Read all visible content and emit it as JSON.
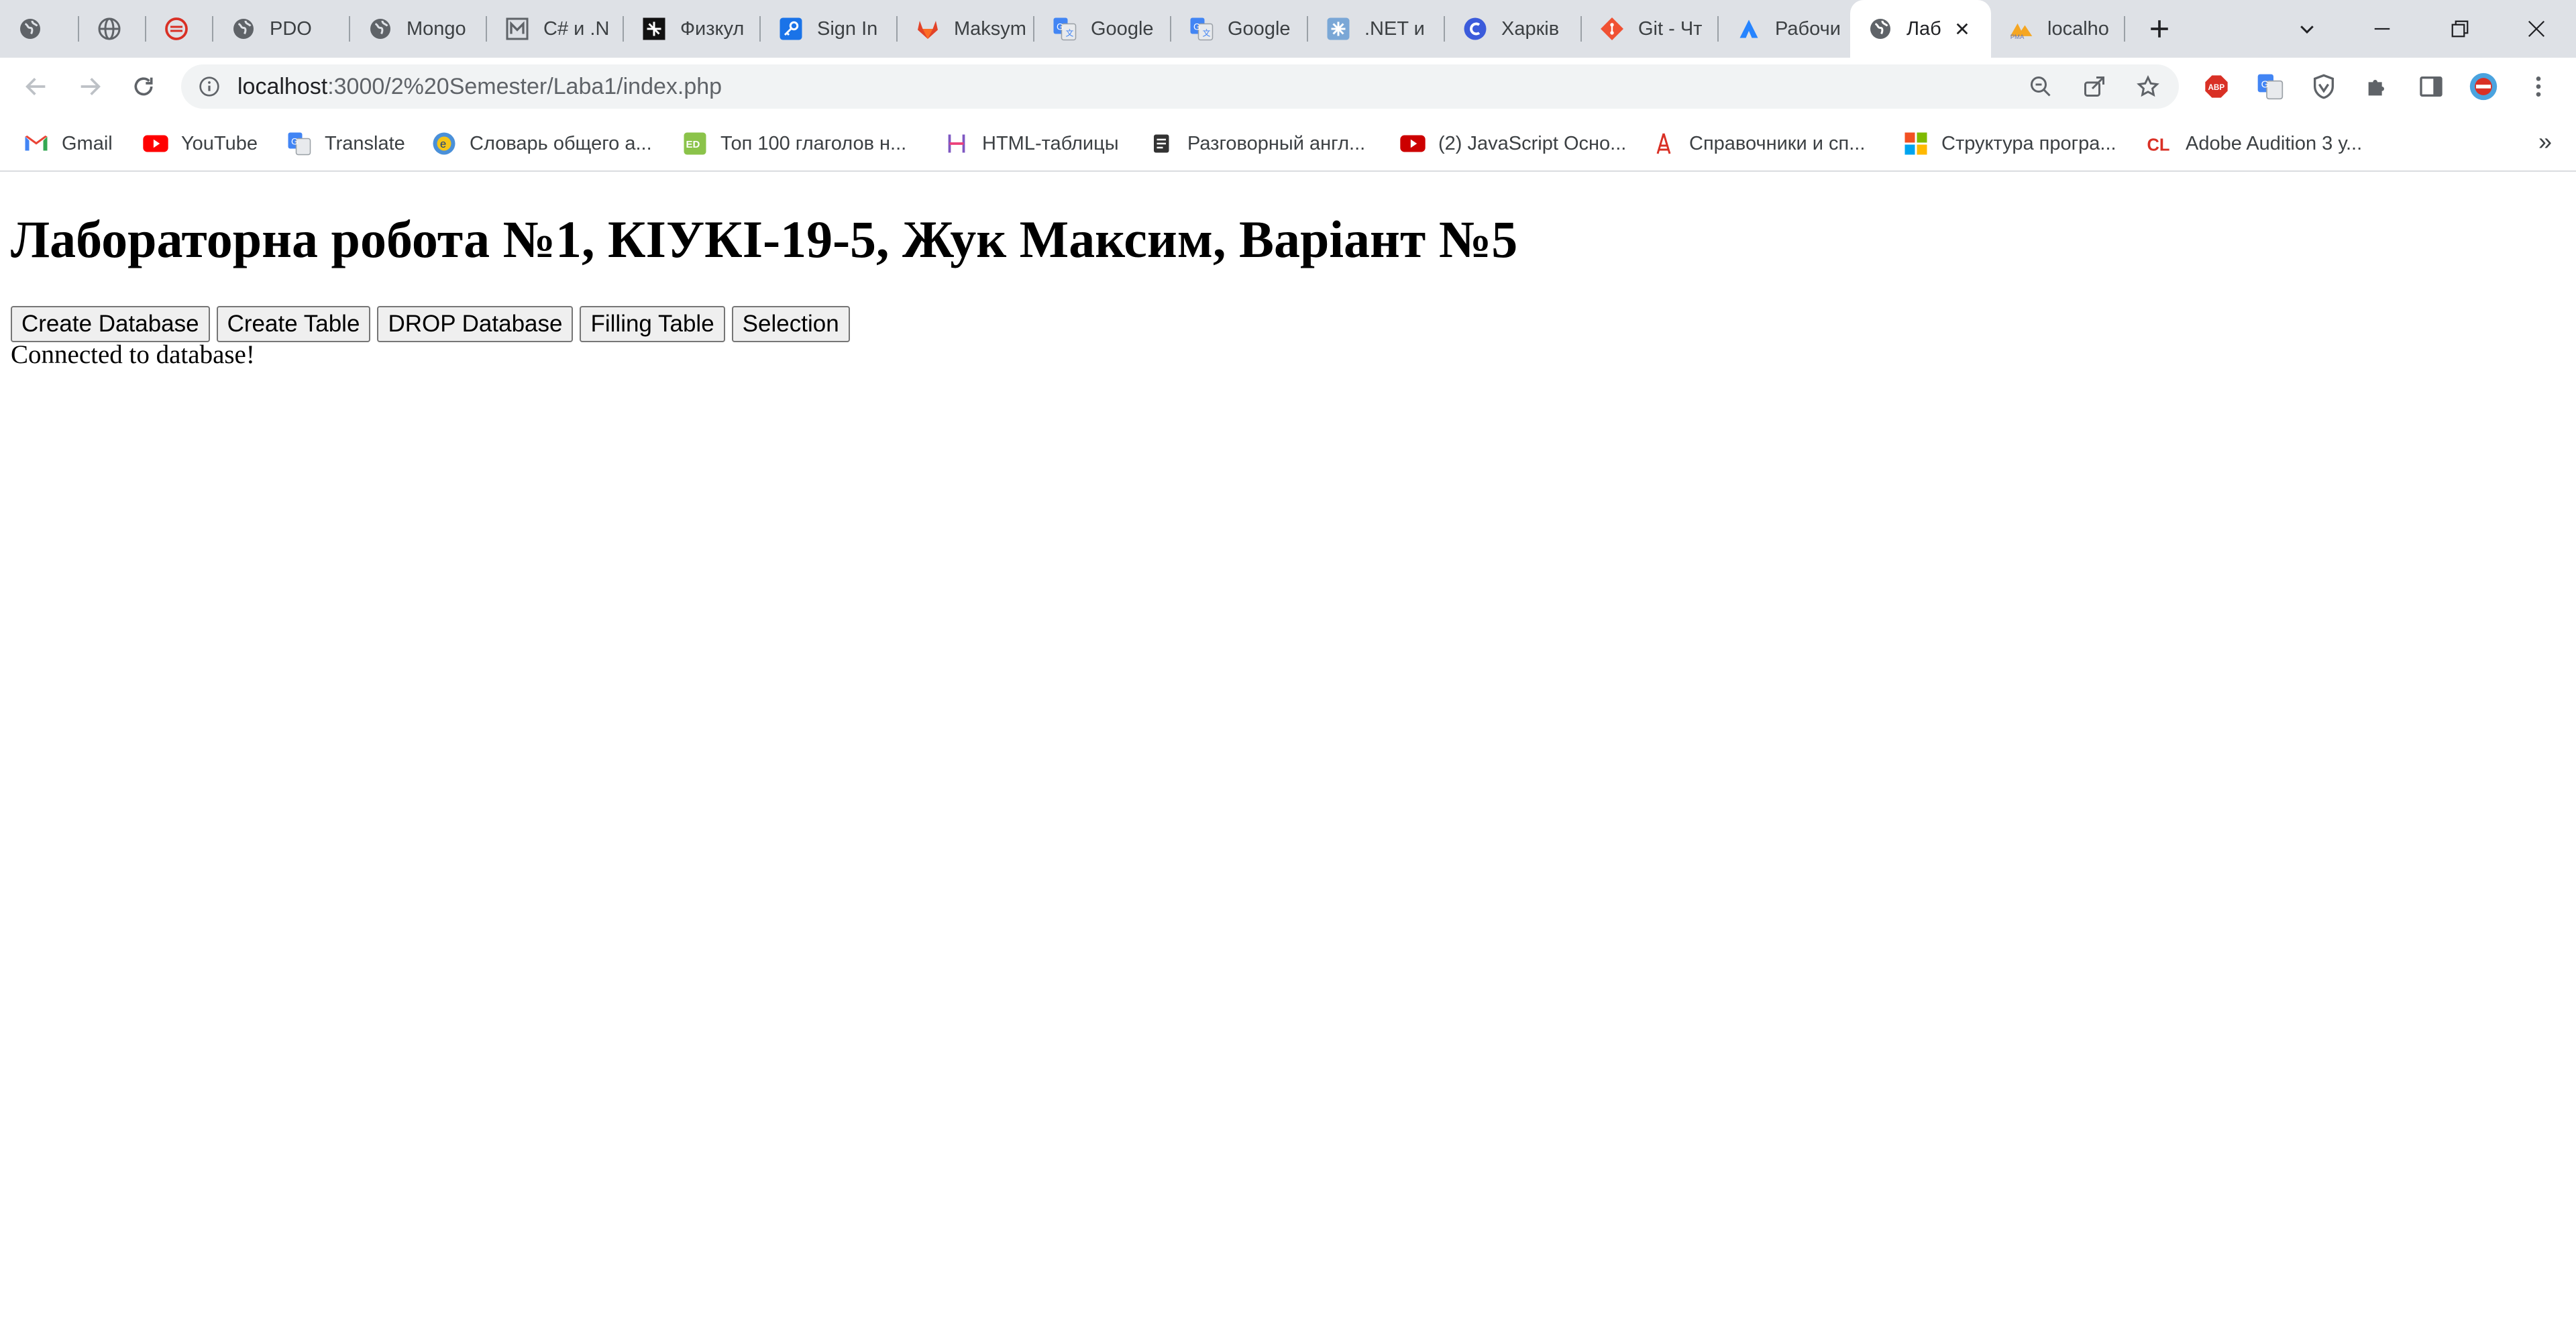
{
  "tabs": [
    {
      "title": "",
      "icon": "globe-icon"
    },
    {
      "title": "",
      "icon": "world-icon"
    },
    {
      "title": "",
      "icon": "opera-icon"
    },
    {
      "title": "PDO",
      "icon": "globe-icon"
    },
    {
      "title": "Mongo",
      "icon": "globe-icon"
    },
    {
      "title": "C# и .N",
      "icon": "m-icon"
    },
    {
      "title": "Физкул",
      "icon": "dark-logo-icon"
    },
    {
      "title": "Sign In",
      "icon": "key-icon"
    },
    {
      "title": "Maksym",
      "icon": "gitlab-icon"
    },
    {
      "title": "Google",
      "icon": "google-translate-icon"
    },
    {
      "title": "Google",
      "icon": "google-translate-icon"
    },
    {
      "title": ".NET и",
      "icon": "asterisk-icon"
    },
    {
      "title": "Харків",
      "icon": "c-icon"
    },
    {
      "title": "Git - Чт",
      "icon": "git-icon"
    },
    {
      "title": "Рабочи",
      "icon": "atlassian-icon"
    },
    {
      "title": "Лаб",
      "icon": "globe-icon",
      "active": true
    },
    {
      "title": "localho",
      "icon": "phpmyadmin-icon"
    }
  ],
  "address_bar": {
    "host": "localhost",
    "path": ":3000/2%20Semester/Laba1/index.php"
  },
  "bookmarks": [
    {
      "label": "Gmail",
      "icon": "gmail-icon"
    },
    {
      "label": "YouTube",
      "icon": "youtube-icon"
    },
    {
      "label": "Translate",
      "icon": "google-translate-icon"
    },
    {
      "label": "Словарь общего а...",
      "icon": "e-icon"
    },
    {
      "label": "Топ 100 глаголов н...",
      "icon": "ed-icon"
    },
    {
      "label": "HTML-таблицы",
      "icon": "html-icon"
    },
    {
      "label": "Разговорный англ...",
      "icon": "scroll-icon"
    },
    {
      "label": "(2) JavaScript Осно...",
      "icon": "youtube-icon"
    },
    {
      "label": "Справочники и сп...",
      "icon": "tower-icon"
    },
    {
      "label": "Структура програ...",
      "icon": "microsoft-icon"
    },
    {
      "label": "Adobe Audition 3 у...",
      "icon": "cl-icon"
    }
  ],
  "bookmarks_overflow": "»",
  "page": {
    "heading": "Лабораторна робота №1, КІУКІ-19-5, Жук Максим, Варіант №5",
    "buttons": [
      "Create Database",
      "Create Table",
      "DROP Database",
      "Filling Table",
      "Selection"
    ],
    "status": "Connected to database!"
  },
  "colors": {
    "tabstrip_bg": "#dee1e6",
    "omnibox_bg": "#f1f3f4",
    "youtube_red": "#ff0000",
    "gitlab_orange": "#e24329"
  }
}
